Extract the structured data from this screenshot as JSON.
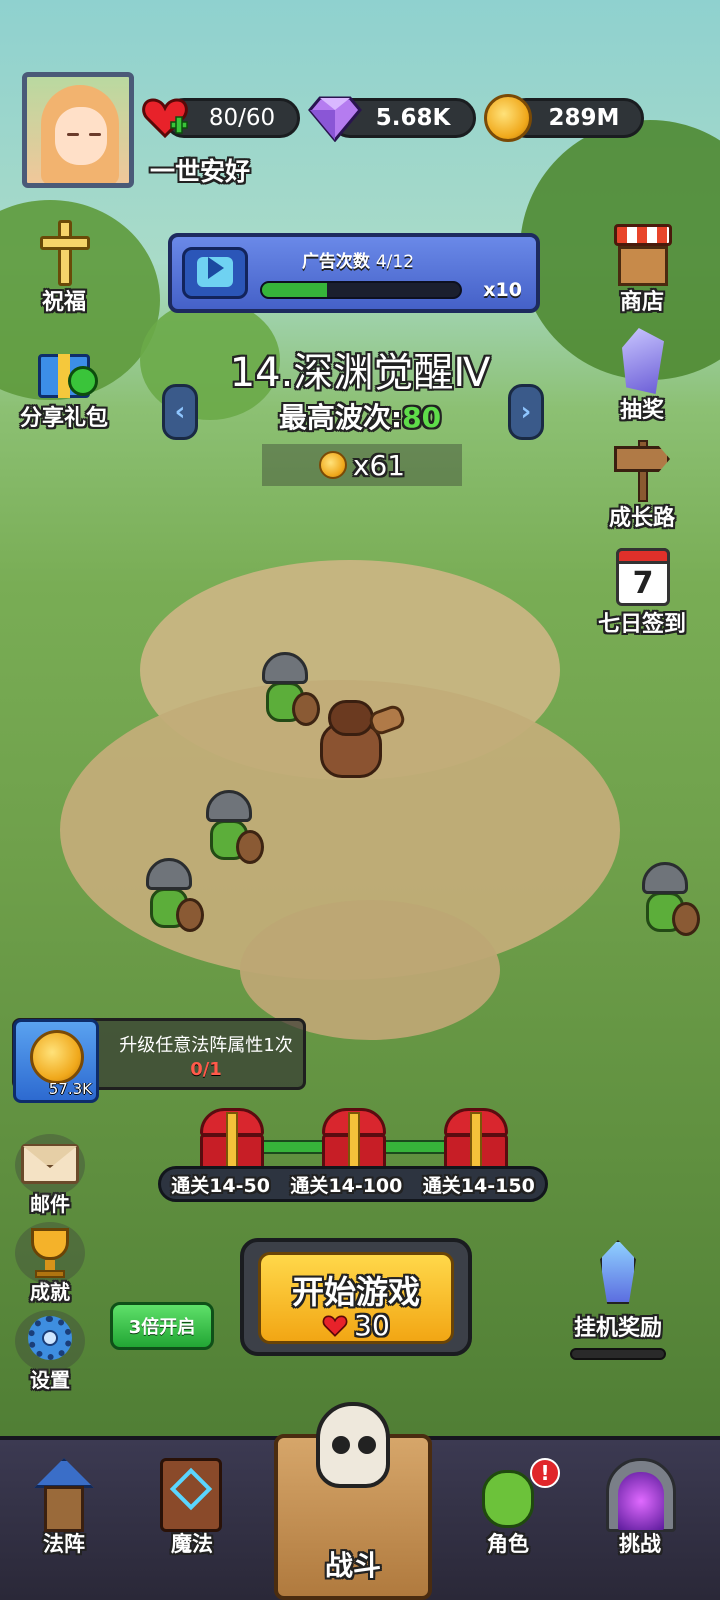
{
  "player": {
    "name": "一世安好",
    "energy": "80/60",
    "gems": "5.68K",
    "gold": "289M"
  },
  "side_left": {
    "blessing": "祝福",
    "share_gift": "分享礼包"
  },
  "side_right": {
    "shop": "商店",
    "lottery": "抽奖",
    "growth_path": "成长路",
    "seven_day": "七日签到",
    "calendar_day": "7"
  },
  "ad_bar": {
    "title": "广告次数",
    "count": "4/12",
    "progress": 0.33,
    "multiplier": "x10"
  },
  "stage": {
    "title": "14.深渊觉醒Ⅳ",
    "wave_label": "最高波次:",
    "wave_value": "80",
    "coin_reward": "x61",
    "prev_icon": "chevron-left-icon",
    "next_icon": "chevron-right-icon"
  },
  "task": {
    "amount": "57.3K",
    "description": "升级任意法阵属性1次",
    "progress": "0/1"
  },
  "chests": {
    "labels": [
      "通关14-50",
      "通关14-100",
      "通关14-150"
    ]
  },
  "left_bottom": {
    "mail": "邮件",
    "achievement": "成就",
    "settings": "设置"
  },
  "triple_button": "3倍开启",
  "start_button": {
    "label": "开始游戏",
    "cost": "30"
  },
  "idle_reward": "挂机奖励",
  "nav": {
    "formation": "法阵",
    "magic": "魔法",
    "battle": "战斗",
    "character": "角色",
    "challenge": "挑战",
    "character_badge": "!"
  },
  "colors": {
    "accent_green": "#36b43a",
    "wave_green": "#5fdc4a",
    "task_red": "#ff5a4a",
    "start_gold": "#f2a614"
  }
}
